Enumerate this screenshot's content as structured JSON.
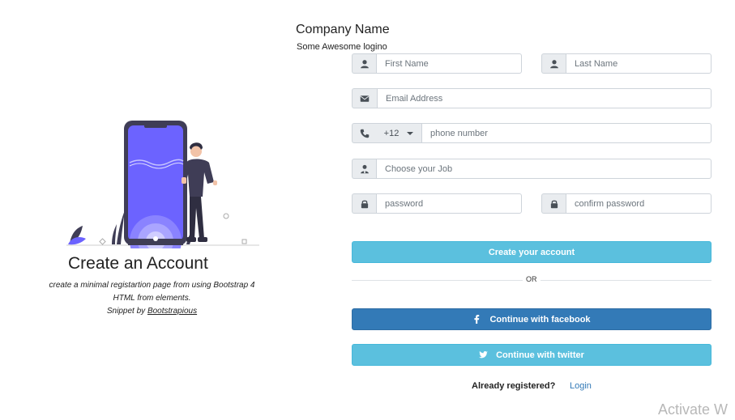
{
  "header": {
    "company_name": "Company Name",
    "tagline": "Some Awesome logino"
  },
  "left": {
    "title": "Create an Account",
    "desc_line1": "create a minimal registartion page from using Bootstrap 4",
    "desc_line2": "HTML from elements.",
    "snippet_prefix": "Snippet by ",
    "snippet_link": "Bootstrapious"
  },
  "form": {
    "first_name_placeholder": "First Name",
    "last_name_placeholder": "Last Name",
    "email_placeholder": "Email Address",
    "country_code": "+12",
    "phone_placeholder": "phone number",
    "job_placeholder": "Choose your Job",
    "password_placeholder": "password",
    "confirm_password_placeholder": "confirm password",
    "create_button": "Create your account",
    "or_label": "OR",
    "facebook_button": "Continue with facebook",
    "twitter_button": "Continue with twitter",
    "already_registered": "Already registered?",
    "login_link": "Login"
  },
  "watermark": "Activate W",
  "icons": {
    "user": "user-icon",
    "envelope": "envelope-icon",
    "phone": "phone-icon",
    "job": "user-tie-icon",
    "lock": "lock-icon",
    "facebook": "facebook-icon",
    "twitter": "twitter-icon"
  },
  "colors": {
    "info_button": "#5bc0de",
    "facebook_button": "#337ab7",
    "illustration_accent": "#6c63ff"
  }
}
